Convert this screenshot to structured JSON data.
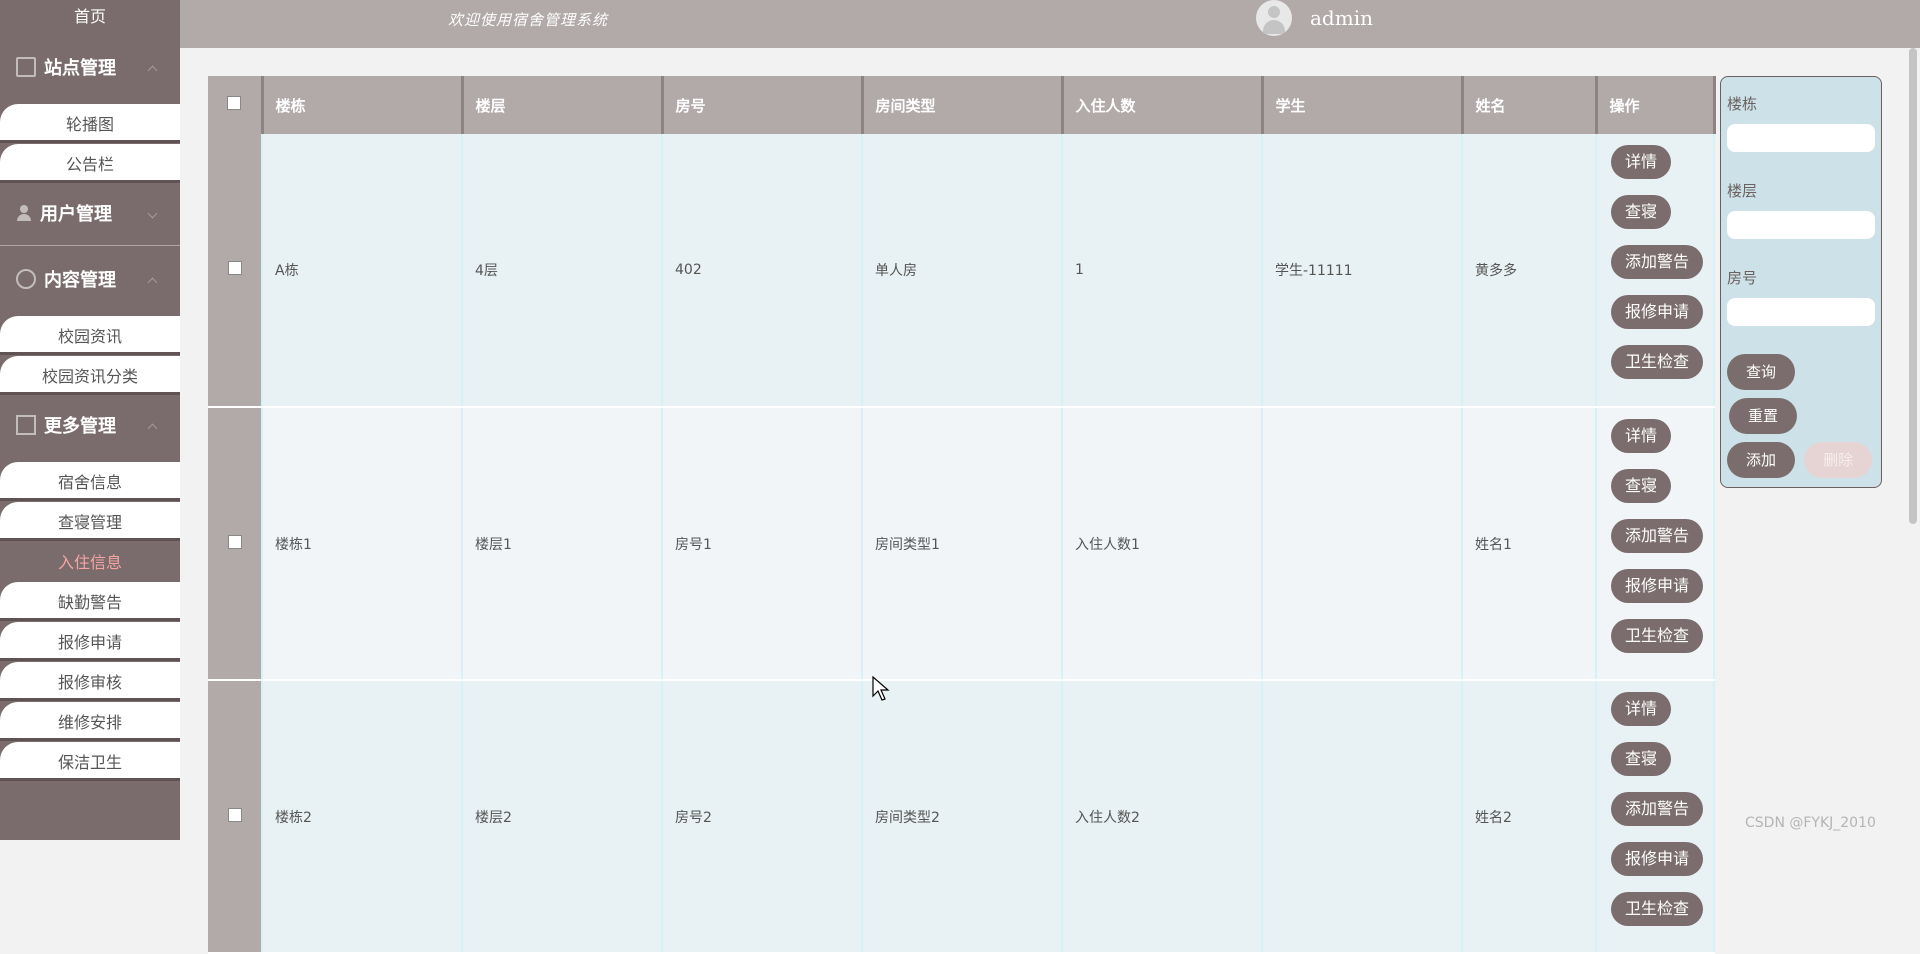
{
  "sidebar": {
    "home": "首页",
    "groups": [
      {
        "label": "站点管理",
        "icon": "monitor-icon",
        "items": [
          "轮播图",
          "公告栏"
        ]
      },
      {
        "label": "用户管理",
        "icon": "user-icon",
        "items": []
      },
      {
        "label": "内容管理",
        "icon": "chat-icon",
        "items": [
          "校园资讯",
          "校园资讯分类"
        ]
      },
      {
        "label": "更多管理",
        "icon": "copy-icon",
        "items": [
          "宿舍信息",
          "查寝管理",
          "入住信息",
          "缺勤警告",
          "报修申请",
          "报修审核",
          "维修安排",
          "保洁卫生"
        ]
      }
    ],
    "active_item": "入住信息"
  },
  "header": {
    "welcome": "欢迎使用宿舍管理系统",
    "username": "admin"
  },
  "table": {
    "headers": [
      "楼栋",
      "楼层",
      "房号",
      "房间类型",
      "入住人数",
      "学生",
      "姓名",
      "操作"
    ],
    "rows": [
      {
        "building": "A栋",
        "floor": "4层",
        "room": "402",
        "type": "单人房",
        "count": "1",
        "student": "学生-11111",
        "name": "黄多多"
      },
      {
        "building": "楼栋1",
        "floor": "楼层1",
        "room": "房号1",
        "type": "房间类型1",
        "count": "入住人数1",
        "student": "",
        "name": "姓名1"
      },
      {
        "building": "楼栋2",
        "floor": "楼层2",
        "room": "房号2",
        "type": "房间类型2",
        "count": "入住人数2",
        "student": "",
        "name": "姓名2"
      }
    ],
    "actions": [
      "详情",
      "查寝",
      "添加警告",
      "报修申请",
      "卫生检查"
    ]
  },
  "search": {
    "fields": [
      "楼栋",
      "楼层",
      "房号"
    ],
    "query_button": "查询",
    "reset_button": "重置",
    "add_button": "添加",
    "delete_button": "删除"
  },
  "watermark": "CSDN @FYKJ_2010"
}
